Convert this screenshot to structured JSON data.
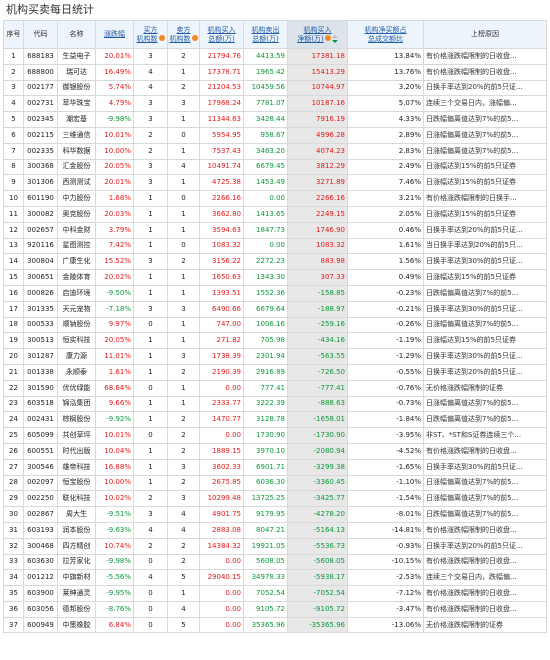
{
  "page": {
    "title": "机构买卖每日统计"
  },
  "headers": {
    "no": "序号",
    "code": "代码",
    "name": "名称",
    "change": "涨跌幅",
    "buy_inst": "买方\n机构数",
    "sell_inst": "卖方\n机构数",
    "buy_amt": "机构买入\n总额(万)",
    "sell_amt": "机构卖出\n总额(万)",
    "net_amt": "机构买入\n净额(万)",
    "ratio": "机构净买额占\n总成交额比",
    "reason": "上榜原因"
  },
  "colors": {
    "up": "#e41a1a",
    "down": "#0a9a39",
    "badge": "#f08a24",
    "header_bg": "#eef4fb",
    "highlight": "#e8e8e8"
  },
  "rows": [
    {
      "no": "1",
      "code": "688183",
      "name": "生益电子",
      "chg": "20.01%",
      "buy": "3",
      "sell": "2",
      "buy_amt": "21794.76",
      "sell_amt": "4413.59",
      "net": "17381.18",
      "ratio": "13.84%",
      "reason": "有价格涨跌幅限制的日收盘..."
    },
    {
      "no": "2",
      "code": "688800",
      "name": "瑞可达",
      "chg": "16.49%",
      "buy": "4",
      "sell": "1",
      "buy_amt": "17378.71",
      "sell_amt": "1965.42",
      "net": "15413.29",
      "ratio": "13.76%",
      "reason": "有价格涨跌幅限制的日收盘..."
    },
    {
      "no": "3",
      "code": "002177",
      "name": "御银股份",
      "chg": "5.74%",
      "buy": "4",
      "sell": "2",
      "buy_amt": "21204.53",
      "sell_amt": "10459.56",
      "net": "10744.97",
      "ratio": "3.20%",
      "reason": "日换手率达到20%的前5只证..."
    },
    {
      "no": "4",
      "code": "002731",
      "name": "萃华珠宝",
      "chg": "4.79%",
      "buy": "3",
      "sell": "3",
      "buy_amt": "17968.24",
      "sell_amt": "7781.07",
      "net": "10187.16",
      "ratio": "5.07%",
      "reason": "连续三个交易日内，涨幅偏..."
    },
    {
      "no": "5",
      "code": "002345",
      "name": "潮宏基",
      "chg": "-9.98%",
      "buy": "3",
      "sell": "1",
      "buy_amt": "11344.63",
      "sell_amt": "3428.44",
      "net": "7916.19",
      "ratio": "4.33%",
      "reason": "日跌幅偏离值达到7%的前5..."
    },
    {
      "no": "6",
      "code": "002115",
      "name": "三维通信",
      "chg": "10.01%",
      "buy": "2",
      "sell": "0",
      "buy_amt": "5954.95",
      "sell_amt": "958.67",
      "net": "4996.28",
      "ratio": "2.89%",
      "reason": "日涨幅偏离值达到7%的前5..."
    },
    {
      "no": "7",
      "code": "002335",
      "name": "科华数据",
      "chg": "10.00%",
      "buy": "2",
      "sell": "1",
      "buy_amt": "7537.43",
      "sell_amt": "3463.20",
      "net": "4074.23",
      "ratio": "2.83%",
      "reason": "日涨幅偏离值达到7%的前5..."
    },
    {
      "no": "8",
      "code": "300368",
      "name": "汇金股份",
      "chg": "20.05%",
      "buy": "3",
      "sell": "4",
      "buy_amt": "10491.74",
      "sell_amt": "6679.45",
      "net": "3812.29",
      "ratio": "2.49%",
      "reason": "日涨幅达到15%的前5只证券"
    },
    {
      "no": "9",
      "code": "301306",
      "name": "西测测试",
      "chg": "20.01%",
      "buy": "3",
      "sell": "1",
      "buy_amt": "4725.38",
      "sell_amt": "1453.49",
      "net": "3271.89",
      "ratio": "7.46%",
      "reason": "日涨幅达到15%的前5只证券"
    },
    {
      "no": "10",
      "code": "601190",
      "name": "中力股份",
      "chg": "1.68%",
      "buy": "1",
      "sell": "0",
      "buy_amt": "2266.16",
      "sell_amt": "0.00",
      "net": "2266.16",
      "ratio": "3.21%",
      "reason": "有价格涨跌幅限制的日换手..."
    },
    {
      "no": "11",
      "code": "300082",
      "name": "奥克股份",
      "chg": "20.03%",
      "buy": "1",
      "sell": "1",
      "buy_amt": "3662.80",
      "sell_amt": "1413.65",
      "net": "2249.15",
      "ratio": "2.05%",
      "reason": "日涨幅达到15%的前5只证券"
    },
    {
      "no": "12",
      "code": "002657",
      "name": "中科金财",
      "chg": "3.79%",
      "buy": "1",
      "sell": "1",
      "buy_amt": "3594.63",
      "sell_amt": "1847.73",
      "net": "1746.90",
      "ratio": "0.46%",
      "reason": "日换手率达到20%的前5只证..."
    },
    {
      "no": "13",
      "code": "920116",
      "name": "星图测控",
      "chg": "7.42%",
      "buy": "1",
      "sell": "0",
      "buy_amt": "1083.32",
      "sell_amt": "0.00",
      "net": "1083.32",
      "ratio": "1.61%",
      "reason": "当日换手率达到20%的前5只..."
    },
    {
      "no": "14",
      "code": "300804",
      "name": "广康生化",
      "chg": "15.52%",
      "buy": "3",
      "sell": "2",
      "buy_amt": "3156.22",
      "sell_amt": "2272.23",
      "net": "883.98",
      "ratio": "1.56%",
      "reason": "日换手率达到30%的前5只证..."
    },
    {
      "no": "15",
      "code": "300651",
      "name": "金陵体育",
      "chg": "20.02%",
      "buy": "1",
      "sell": "1",
      "buy_amt": "1650.63",
      "sell_amt": "1343.30",
      "net": "307.33",
      "ratio": "0.49%",
      "reason": "日涨幅达到15%的前5只证券"
    },
    {
      "no": "16",
      "code": "000826",
      "name": "启迪环境",
      "chg": "-9.50%",
      "buy": "1",
      "sell": "1",
      "buy_amt": "1393.51",
      "sell_amt": "1552.36",
      "net": "-158.85",
      "ratio": "-0.23%",
      "reason": "日跌幅偏离值达到7%的前5..."
    },
    {
      "no": "17",
      "code": "301335",
      "name": "天元宠物",
      "chg": "-7.18%",
      "buy": "3",
      "sell": "3",
      "buy_amt": "6490.66",
      "sell_amt": "6679.64",
      "net": "-188.97",
      "ratio": "-0.21%",
      "reason": "日换手率达到30%的前5只证..."
    },
    {
      "no": "18",
      "code": "000533",
      "name": "顺钠股份",
      "chg": "9.97%",
      "buy": "0",
      "sell": "1",
      "buy_amt": "747.00",
      "sell_amt": "1006.16",
      "net": "-259.16",
      "ratio": "-0.26%",
      "reason": "日涨幅偏离值达到7%的前5..."
    },
    {
      "no": "19",
      "code": "300513",
      "name": "恒实科技",
      "chg": "20.05%",
      "buy": "1",
      "sell": "1",
      "buy_amt": "271.82",
      "sell_amt": "705.98",
      "net": "-434.16",
      "ratio": "-1.19%",
      "reason": "日涨幅达到15%的前5只证券"
    },
    {
      "no": "20",
      "code": "301287",
      "name": "康力源",
      "chg": "11.01%",
      "buy": "1",
      "sell": "3",
      "buy_amt": "1738.39",
      "sell_amt": "2301.94",
      "net": "-563.55",
      "ratio": "-1.29%",
      "reason": "日换手率达到30%的前5只证..."
    },
    {
      "no": "21",
      "code": "001338",
      "name": "永顺泰",
      "chg": "1.61%",
      "buy": "1",
      "sell": "2",
      "buy_amt": "2190.39",
      "sell_amt": "2916.89",
      "net": "-726.50",
      "ratio": "-0.55%",
      "reason": "日换手率达到20%的前5只证..."
    },
    {
      "no": "22",
      "code": "301590",
      "name": "优优绿能",
      "chg": "68.64%",
      "buy": "0",
      "sell": "1",
      "buy_amt": "0.00",
      "sell_amt": "777.41",
      "net": "-777.41",
      "ratio": "-0.76%",
      "reason": "无价格涨跌幅限制的证券"
    },
    {
      "no": "23",
      "code": "603518",
      "name": "锦泓集团",
      "chg": "9.66%",
      "buy": "1",
      "sell": "1",
      "buy_amt": "2333.77",
      "sell_amt": "3222.39",
      "net": "-888.63",
      "ratio": "-0.73%",
      "reason": "日涨幅偏离值达到7%的前5..."
    },
    {
      "no": "24",
      "code": "002431",
      "name": "棕榈股份",
      "chg": "-9.92%",
      "buy": "1",
      "sell": "2",
      "buy_amt": "1470.77",
      "sell_amt": "3128.78",
      "net": "-1658.01",
      "ratio": "-1.84%",
      "reason": "日跌幅偏离值达到7%的前5..."
    },
    {
      "no": "25",
      "code": "605099",
      "name": "共创草坪",
      "chg": "10.01%",
      "buy": "0",
      "sell": "2",
      "buy_amt": "0.00",
      "sell_amt": "1730.90",
      "net": "-1730.90",
      "ratio": "-3.95%",
      "reason": "非ST、*ST和S证券连续三个..."
    },
    {
      "no": "26",
      "code": "600551",
      "name": "时代出版",
      "chg": "10.04%",
      "buy": "1",
      "sell": "2",
      "buy_amt": "1889.15",
      "sell_amt": "3970.10",
      "net": "-2080.94",
      "ratio": "-4.52%",
      "reason": "有价格涨跌幅限制的日收盘..."
    },
    {
      "no": "27",
      "code": "300546",
      "name": "雄帝科技",
      "chg": "16.88%",
      "buy": "1",
      "sell": "3",
      "buy_amt": "3602.33",
      "sell_amt": "6901.71",
      "net": "-3299.38",
      "ratio": "-1.65%",
      "reason": "日换手率达到30%的前5只证..."
    },
    {
      "no": "28",
      "code": "002097",
      "name": "恒宝股份",
      "chg": "10.00%",
      "buy": "1",
      "sell": "2",
      "buy_amt": "2675.85",
      "sell_amt": "6036.30",
      "net": "-3360.45",
      "ratio": "-1.10%",
      "reason": "日涨幅偏离值达到7%的前5..."
    },
    {
      "no": "29",
      "code": "002250",
      "name": "联化科技",
      "chg": "10.02%",
      "buy": "2",
      "sell": "3",
      "buy_amt": "10299.48",
      "sell_amt": "13725.25",
      "net": "-3425.77",
      "ratio": "-1.54%",
      "reason": "日涨幅偏离值达到7%的前5..."
    },
    {
      "no": "30",
      "code": "002867",
      "name": "周大生",
      "chg": "-9.51%",
      "buy": "3",
      "sell": "4",
      "buy_amt": "4901.75",
      "sell_amt": "9179.95",
      "net": "-4278.20",
      "ratio": "-8.01%",
      "reason": "日跌幅偏离值达到7%的前5..."
    },
    {
      "no": "31",
      "code": "603193",
      "name": "润本股份",
      "chg": "-9.63%",
      "buy": "4",
      "sell": "4",
      "buy_amt": "2883.08",
      "sell_amt": "8047.21",
      "net": "-5164.13",
      "ratio": "-14.81%",
      "reason": "有价格涨跌幅限制的日收盘..."
    },
    {
      "no": "32",
      "code": "300468",
      "name": "四方精创",
      "chg": "10.74%",
      "buy": "2",
      "sell": "2",
      "buy_amt": "14384.32",
      "sell_amt": "19921.05",
      "net": "-5536.73",
      "ratio": "-0.93%",
      "reason": "日换手率达到20%的前5只证..."
    },
    {
      "no": "33",
      "code": "603630",
      "name": "拉芳家化",
      "chg": "-9.98%",
      "buy": "0",
      "sell": "2",
      "buy_amt": "0.00",
      "sell_amt": "5608.05",
      "net": "-5608.05",
      "ratio": "-10.15%",
      "reason": "有价格涨跌幅限制的日收盘..."
    },
    {
      "no": "34",
      "code": "001212",
      "name": "中旗新材",
      "chg": "-5.56%",
      "buy": "4",
      "sell": "5",
      "buy_amt": "29040.15",
      "sell_amt": "34978.33",
      "net": "-5938.17",
      "ratio": "-2.53%",
      "reason": "连续三个交易日内，跌幅偏..."
    },
    {
      "no": "35",
      "code": "603900",
      "name": "莱绅通灵",
      "chg": "-9.95%",
      "buy": "0",
      "sell": "1",
      "buy_amt": "0.00",
      "sell_amt": "7052.54",
      "net": "-7052.54",
      "ratio": "-7.12%",
      "reason": "有价格涨跌幅限制的日收盘..."
    },
    {
      "no": "36",
      "code": "603056",
      "name": "德邦股份",
      "chg": "-8.76%",
      "buy": "0",
      "sell": "4",
      "buy_amt": "0.00",
      "sell_amt": "9105.72",
      "net": "-9105.72",
      "ratio": "-3.47%",
      "reason": "有价格涨跌幅限制的日收盘..."
    },
    {
      "no": "37",
      "code": "600949",
      "name": "中策橡胶",
      "chg": "6.84%",
      "buy": "0",
      "sell": "5",
      "buy_amt": "0.00",
      "sell_amt": "35365.96",
      "net": "-35365.96",
      "ratio": "-13.06%",
      "reason": "无价格涨跌幅限制的证券"
    }
  ]
}
